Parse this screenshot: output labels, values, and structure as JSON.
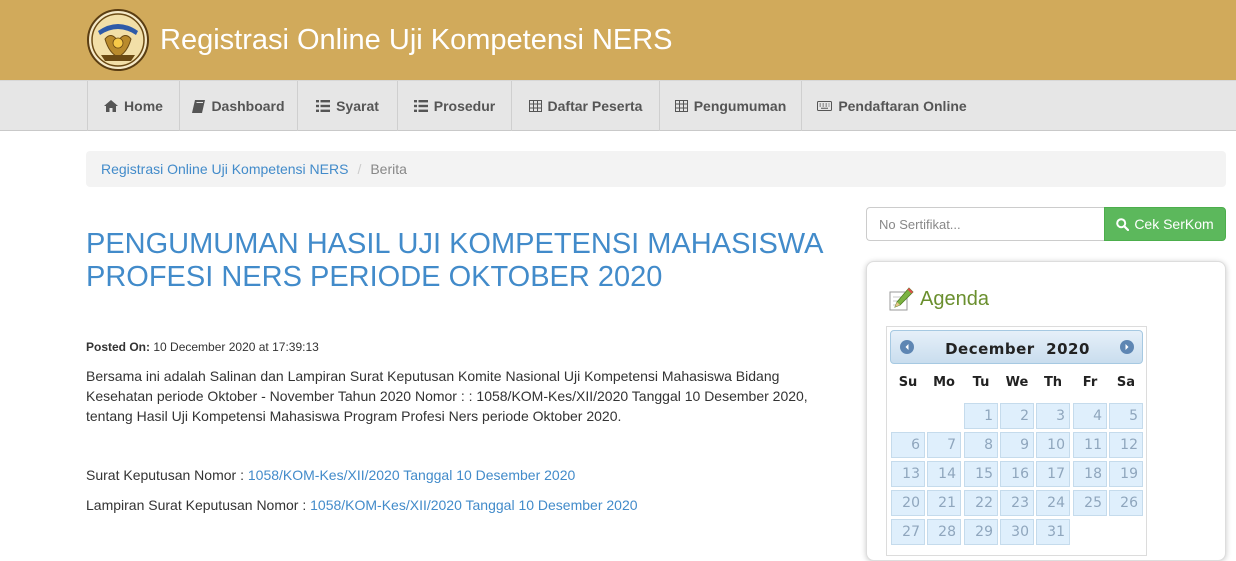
{
  "header": {
    "site_title": "Registrasi Online Uji Kompetensi NERS",
    "logo_icon": "tut-wuri-handayani-logo",
    "background": "#d1aa5b"
  },
  "nav": {
    "items": [
      {
        "label": "Home",
        "icon": "home-icon"
      },
      {
        "label": "Dashboard",
        "icon": "book-icon"
      },
      {
        "label": "Syarat",
        "icon": "list-icon"
      },
      {
        "label": "Prosedur",
        "icon": "list-icon"
      },
      {
        "label": "Daftar Peserta",
        "icon": "table-icon"
      },
      {
        "label": "Pengumuman",
        "icon": "table-icon"
      },
      {
        "label": "Pendaftaran Online",
        "icon": "keyboard-icon"
      }
    ]
  },
  "breadcrumb": {
    "home": "Registrasi Online Uji Kompetensi NERS",
    "separator": "/",
    "current": "Berita"
  },
  "article": {
    "title": "PENGUMUMAN HASIL UJI KOMPETENSI MAHASISWA PROFESI NERS PERIODE OKTOBER 2020",
    "posted_label": "Posted On:",
    "posted_value": "10 December 2020 at 17:39:13",
    "body": "Bersama ini adalah  Salinan dan Lampiran Surat Keputusan Komite Nasional Uji Kompetensi Mahasiswa Bidang Kesehatan periode Oktober - November Tahun 2020 Nomor : : 1058/KOM-Kes/XII/2020 Tanggal 10 Desember 2020, tentang Hasil Uji Kompetensi Mahasiswa Program Profesi Ners periode Oktober 2020.",
    "sk_label": "Surat Keputusan Nomor : ",
    "sk_link": "1058/KOM-Kes/XII/2020 Tanggal 10 Desember 2020",
    "lampiran_label": "Lampiran Surat Keputusan Nomor : ",
    "lampiran_link": "1058/KOM-Kes/XII/2020 Tanggal 10 Desember 2020"
  },
  "search": {
    "placeholder": "No Sertifikat...",
    "value": "",
    "button_label": "Cek SerKom",
    "button_color": "#5cb85c"
  },
  "agenda": {
    "title": "Agenda",
    "calendar": {
      "month": "December",
      "year": "2020",
      "weekdays": [
        "Su",
        "Mo",
        "Tu",
        "We",
        "Th",
        "Fr",
        "Sa"
      ],
      "leading_blanks": 2,
      "days": [
        "1",
        "2",
        "3",
        "4",
        "5",
        "6",
        "7",
        "8",
        "9",
        "10",
        "11",
        "12",
        "13",
        "14",
        "15",
        "16",
        "17",
        "18",
        "19",
        "20",
        "21",
        "22",
        "23",
        "24",
        "25",
        "26",
        "27",
        "28",
        "29",
        "30",
        "31"
      ]
    }
  },
  "colors": {
    "link": "#428bca",
    "agenda_title": "#6a8f2e"
  }
}
